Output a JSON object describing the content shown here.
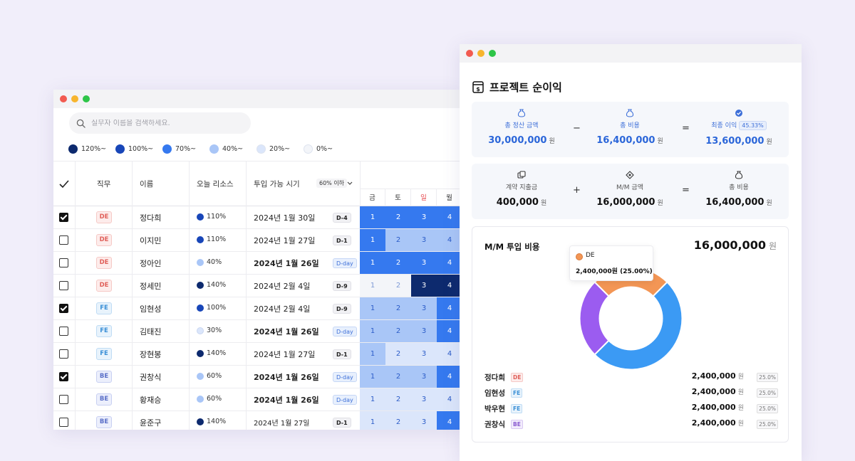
{
  "search": {
    "placeholder": "실무자 이름을 검색하세요."
  },
  "legend": [
    {
      "label": "120%~",
      "color": "#0d2a6e"
    },
    {
      "label": "100%~",
      "color": "#1846b8"
    },
    {
      "label": "70%~",
      "color": "#3579ef"
    },
    {
      "label": "40%~",
      "color": "#a9c6f7"
    },
    {
      "label": "20%~",
      "color": "#dbe6fb"
    },
    {
      "label": "0%~",
      "color": "#f3f5f9"
    }
  ],
  "table": {
    "headers": {
      "role": "직무",
      "name": "이름",
      "risk": "오늘 리소스",
      "avail": "투입 가능 시기",
      "filter": "60% 이하"
    },
    "days": [
      "금",
      "토",
      "일",
      "월"
    ],
    "rows": [
      {
        "checked": true,
        "role": "DE",
        "name": "정다희",
        "risk": "110%",
        "risk_color": "#1846b8",
        "date": "2024년 1월 30일",
        "date_style": "normal",
        "badge": "D-4",
        "cells": [
          "1",
          "2",
          "3",
          "4"
        ],
        "cell_levels": [
          "#3579ef",
          "#3579ef",
          "#3579ef",
          "#3579ef"
        ]
      },
      {
        "checked": false,
        "role": "DE",
        "name": "이지민",
        "risk": "110%",
        "risk_color": "#1846b8",
        "date": "2024년 1월 27일",
        "date_style": "normal",
        "badge": "D-1",
        "cells": [
          "1",
          "2",
          "3",
          "4"
        ],
        "cell_levels": [
          "#3579ef",
          "#a9c6f7",
          "#a9c6f7",
          "#a9c6f7"
        ]
      },
      {
        "checked": false,
        "role": "DE",
        "name": "정아인",
        "risk": "40%",
        "risk_color": "#a9c6f7",
        "date": "2024년 1월 26일",
        "date_style": "bold",
        "badge": "D-day",
        "cells": [
          "1",
          "2",
          "3",
          "4"
        ],
        "cell_levels": [
          "#3579ef",
          "#3579ef",
          "#3579ef",
          "#3579ef"
        ]
      },
      {
        "checked": false,
        "role": "DE",
        "name": "정세민",
        "risk": "140%",
        "risk_color": "#0d2a6e",
        "date": "2024년 2월 4일",
        "date_style": "normal",
        "badge": "D-9",
        "cells": [
          "1",
          "2",
          "3",
          "4"
        ],
        "cell_levels": [
          "#f3f5f9",
          "#f3f5f9",
          "#0d2a6e",
          "#0d2a6e"
        ]
      },
      {
        "checked": true,
        "role": "FE",
        "name": "임현성",
        "risk": "100%",
        "risk_color": "#1846b8",
        "date": "2024년 2월 4일",
        "date_style": "normal",
        "badge": "D-9",
        "cells": [
          "1",
          "2",
          "3",
          "4"
        ],
        "cell_levels": [
          "#a9c6f7",
          "#a9c6f7",
          "#a9c6f7",
          "#3579ef"
        ]
      },
      {
        "checked": false,
        "role": "FE",
        "name": "김태진",
        "risk": "30%",
        "risk_color": "#dbe6fb",
        "date": "2024년 1월 26일",
        "date_style": "bold",
        "badge": "D-day",
        "cells": [
          "1",
          "2",
          "3",
          "4"
        ],
        "cell_levels": [
          "#a9c6f7",
          "#a9c6f7",
          "#a9c6f7",
          "#3579ef"
        ]
      },
      {
        "checked": false,
        "role": "FE",
        "name": "장현봉",
        "risk": "140%",
        "risk_color": "#0d2a6e",
        "date": "2024년 1월 27일",
        "date_style": "normal",
        "badge": "D-1",
        "cells": [
          "1",
          "2",
          "3",
          "4"
        ],
        "cell_levels": [
          "#a9c6f7",
          "#dbe6fb",
          "#dbe6fb",
          "#dbe6fb"
        ]
      },
      {
        "checked": true,
        "role": "BE",
        "name": "권창식",
        "risk": "60%",
        "risk_color": "#a9c6f7",
        "date": "2024년 1월 26일",
        "date_style": "bold",
        "badge": "D-day",
        "cells": [
          "1",
          "2",
          "3",
          "4"
        ],
        "cell_levels": [
          "#a9c6f7",
          "#a9c6f7",
          "#a9c6f7",
          "#3579ef"
        ]
      },
      {
        "checked": false,
        "role": "BE",
        "name": "황재승",
        "risk": "60%",
        "risk_color": "#a9c6f7",
        "date": "2024년 1월 26일",
        "date_style": "bold",
        "badge": "D-day",
        "cells": [
          "1",
          "2",
          "3",
          "4"
        ],
        "cell_levels": [
          "#dbe6fb",
          "#dbe6fb",
          "#dbe6fb",
          "#dbe6fb"
        ]
      },
      {
        "checked": false,
        "role": "BE",
        "name": "윤준구",
        "risk": "140%",
        "risk_color": "#0d2a6e",
        "date": "2024년 1월 27일",
        "date_style": "small",
        "badge": "D-1",
        "cells": [
          "1",
          "2",
          "3",
          "4"
        ],
        "cell_levels": [
          "#dbe6fb",
          "#dbe6fb",
          "#dbe6fb",
          "#3579ef"
        ]
      }
    ]
  },
  "profit": {
    "title": "프로젝트 순이익",
    "top": {
      "settle_label": "총 정산 금액",
      "settle_value": "30,000,000",
      "cost_label": "총 비용",
      "cost_value": "16,400,000",
      "final_label": "최종 이익",
      "final_pct": "45.33%",
      "final_value": "13,600,000",
      "op_minus": "−",
      "op_eq": "="
    },
    "bottom": {
      "contract_label": "계약 지출금",
      "contract_value": "400,000",
      "mm_label": "M/M 금액",
      "mm_value": "16,000,000",
      "total_label": "총 비용",
      "total_value": "16,400,000",
      "op_plus": "+",
      "op_eq": "="
    },
    "unit": "원"
  },
  "mm": {
    "title": "M/M 투입 비용",
    "total": "16,000,000",
    "unit": "원",
    "tooltip": {
      "name": "DE",
      "value": "2,400,000원 (25.00%)"
    },
    "breakdown": [
      {
        "name": "정다희",
        "role": "DE",
        "amount": "2,400,000",
        "pct": "25.0%"
      },
      {
        "name": "임현성",
        "role": "FE",
        "amount": "2,400,000",
        "pct": "25.0%"
      },
      {
        "name": "박우현",
        "role": "FE",
        "amount": "2,400,000",
        "pct": "25.0%"
      },
      {
        "name": "권창식",
        "role": "BE",
        "amount": "2,400,000",
        "pct": "25.0%"
      }
    ],
    "slices": [
      {
        "name": "DE",
        "value": 25,
        "color": "#f39655"
      },
      {
        "name": "FE",
        "value": 50,
        "color": "#3b9af4"
      },
      {
        "name": "BE",
        "value": 25,
        "color": "#9b5cf0"
      }
    ]
  }
}
